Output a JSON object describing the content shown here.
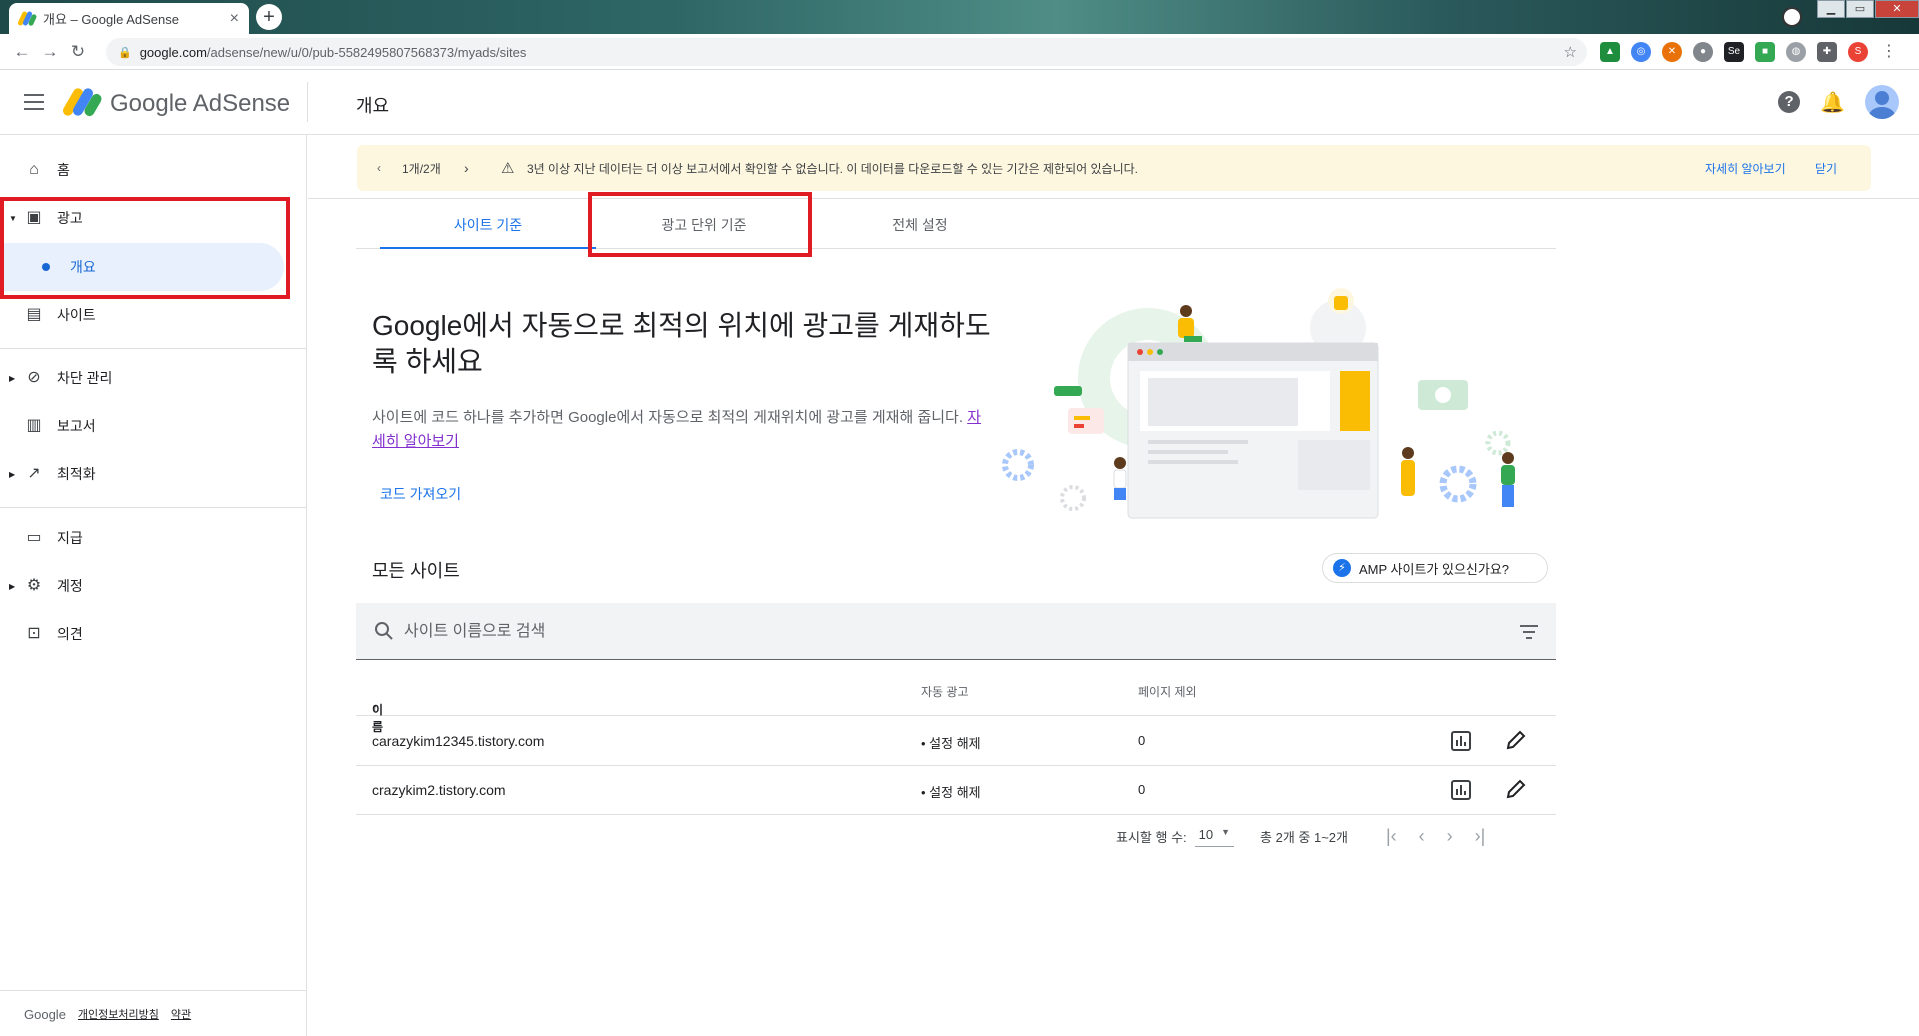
{
  "browser": {
    "tab_title": "개요 – Google AdSense",
    "tab_close": "×",
    "new_tab": "+",
    "url_host": "google.com",
    "url_path": "/adsense/new/u/0/pub-5582495807568373/myads/sites",
    "profile_initial": "S"
  },
  "header": {
    "brand": "Google AdSense",
    "page_title": "개요"
  },
  "sidebar": {
    "items": [
      {
        "label": "홈",
        "icon": "home-icon"
      },
      {
        "label": "광고",
        "icon": "ads-icon"
      },
      {
        "label": "개요",
        "icon": "dot"
      },
      {
        "label": "사이트",
        "icon": "sites-icon"
      },
      {
        "label": "차단 관리",
        "icon": "block-icon"
      },
      {
        "label": "보고서",
        "icon": "reports-icon"
      },
      {
        "label": "최적화",
        "icon": "optimization-icon"
      },
      {
        "label": "지급",
        "icon": "payments-icon"
      },
      {
        "label": "계정",
        "icon": "gear-icon"
      },
      {
        "label": "의견",
        "icon": "feedback-icon"
      }
    ],
    "footer": {
      "google": "Google",
      "privacy": "개인정보처리방침",
      "terms": "약관"
    }
  },
  "banner": {
    "page_indicator": "1개/2개",
    "message": "3년 이상 지난 데이터는 더 이상 보고서에서 확인할 수 없습니다. 이 데이터를 다운로드할 수 있는 기간은 제한되어 있습니다.",
    "learn_more": "자세히 알아보기",
    "close": "닫기"
  },
  "tabs": [
    {
      "label": "사이트 기준",
      "active": true
    },
    {
      "label": "광고 단위 기준",
      "active": false
    },
    {
      "label": "전체 설정",
      "active": false
    }
  ],
  "hero": {
    "title": "Google에서 자동으로 최적의 위치에 광고를 게재하도록 하세요",
    "description": "사이트에 코드 하나를 추가하면 Google에서 자동으로 최적의 게재위치에 광고를 게재해 줍니다.",
    "learn_more_link": "자세히 알아보기",
    "get_code": "코드 가져오기"
  },
  "sites": {
    "section_title": "모든 사이트",
    "amp_chip": "AMP 사이트가 있으신가요?",
    "search_placeholder": "사이트 이름으로 검색",
    "columns": {
      "name": "이름",
      "auto_ads": "자동 광고",
      "page_exclusions": "페이지 제외"
    },
    "rows": [
      {
        "name": "carazykim12345.tistory.com",
        "auto_ads": "• 설정 해제",
        "page_exclusions": "0"
      },
      {
        "name": "crazykim2.tistory.com",
        "auto_ads": "• 설정 해제",
        "page_exclusions": "0"
      }
    ],
    "pagination": {
      "rows_label": "표시할 행 수:",
      "rows_value": "10",
      "range": "총 2개 중 1~2개"
    }
  },
  "colors": {
    "accent": "#1a73e8",
    "active_nav_bg": "#e8f0fe",
    "banner_bg": "#fef7e0",
    "highlight_box": "#e01b24"
  }
}
